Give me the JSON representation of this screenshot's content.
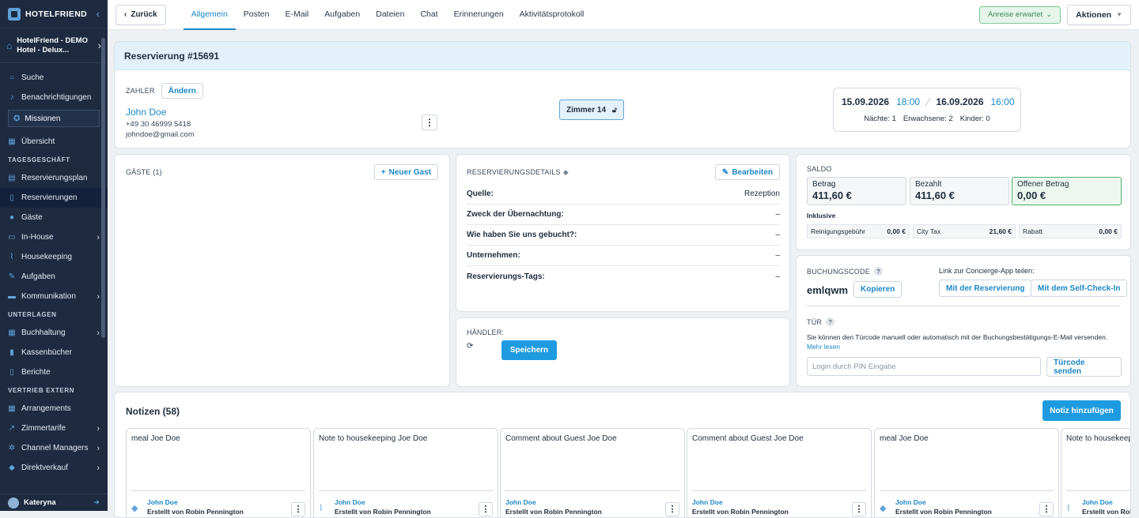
{
  "sidebar": {
    "brand": "HOTELFRIEND",
    "hotel": "HotelFriend - DEMO Hotel - Delux...",
    "search": "Suche",
    "notifications": "Benachrichtigungen",
    "missions": "Missionen",
    "overview": "Übersicht",
    "sections": [
      "TAGESGESCHÄFT",
      "UNTERLAGEN",
      "VERTRIEB EXTERN"
    ],
    "items_daily": [
      "Reservierungsplan",
      "Reservierungen",
      "Gäste",
      "In-House",
      "Housekeeping",
      "Aufgaben",
      "Kommunikation"
    ],
    "items_docs": [
      "Buchhaltung",
      "Kassenbücher",
      "Berichte"
    ],
    "items_sales": [
      "Arrangements",
      "Zimmertarife",
      "Channel Managers",
      "Direktverkauf"
    ],
    "user": "Kateryna"
  },
  "topbar": {
    "back": "Zurück",
    "tabs": [
      "Allgemein",
      "Posten",
      "E-Mail",
      "Aufgaben",
      "Dateien",
      "Chat",
      "Erinnerungen",
      "Aktivitätsprotokoll"
    ],
    "status": "Anreise erwartet",
    "actions": "Aktionen"
  },
  "reservation": {
    "title": "Reservierung #15691",
    "payer_label": "ZAHLER",
    "change": "Ändern",
    "payer_name": "John Doe",
    "payer_phone": "+49 30 46999 5418",
    "payer_email": "johndoe@gmail.com",
    "room": "Zimmer 14",
    "date_from": "15.09.2026",
    "time_from": "18:00",
    "date_to": "16.09.2026",
    "time_to": "16:00",
    "nights": "Nächte: 1",
    "adults": "Erwachsene: 2",
    "children": "Kinder: 0"
  },
  "guests": {
    "title": "GÄSTE (1)",
    "new_guest": "Neuer Gast"
  },
  "details": {
    "title": "RESERVIERUNGSDETAILS",
    "edit": "Bearbeiten",
    "rows": [
      {
        "k": "Quelle:",
        "v": "Rezeption"
      },
      {
        "k": "Zweck der Übernachtung:",
        "v": "–"
      },
      {
        "k": "Wie haben Sie uns gebucht?:",
        "v": "–"
      },
      {
        "k": "Unternehmen:",
        "v": "–"
      },
      {
        "k": "Reservierungs-Tags:",
        "v": "–"
      }
    ]
  },
  "dealer": {
    "title": "HÄNDLER:",
    "save": "Speichern"
  },
  "saldo": {
    "title": "SALDO",
    "amount_label": "Betrag",
    "amount": "411,60 €",
    "paid_label": "Bezahlt",
    "paid": "411,60 €",
    "open_label": "Offener Betrag",
    "open": "0,00 €",
    "incl": "Inklusive",
    "fees": [
      {
        "k": "Reinigungsgebühr",
        "v": "0,00 €"
      },
      {
        "k": "City Tax",
        "v": "21,60 €"
      },
      {
        "k": "Rabatt",
        "v": "0,00 €"
      }
    ]
  },
  "booking": {
    "title": "BUCHUNGSCODE",
    "code": "emlqwm",
    "copy": "Kopieren",
    "share_label": "Link zur Concierge-App teilen:",
    "with_res": "Mit der Reservierung",
    "with_checkin": "Mit dem Self-Check-In",
    "door_title": "TÜR",
    "door_text": "Sie können den Türcode manuell oder automatisch mit der Buchungsbestätigungs-E-Mail versenden.",
    "more": "Mehr lesen",
    "pin_placeholder": "Login durch PIN Eingabe",
    "send_code": "Türcode senden"
  },
  "notes": {
    "title": "Notizen (58)",
    "add": "Notiz hinzufügen",
    "items": [
      {
        "text": "meal Joe Doe",
        "name": "John Doe",
        "by": "Erstellt von Robin Pennington"
      },
      {
        "text": "Note to housekeeping Joe Doe",
        "name": "John Doe",
        "by": "Erstellt von Robin Pennington"
      },
      {
        "text": "Comment about Guest Joe Doe",
        "name": "John Doe",
        "by": "Erstellt von Robin Pennington"
      },
      {
        "text": "Comment about Guest Joe Doe",
        "name": "John Doe",
        "by": "Erstellt von Robin Pennington"
      },
      {
        "text": "meal Joe Doe",
        "name": "John Doe",
        "by": "Erstellt von Robin Pennington"
      },
      {
        "text": "Note to housekeeping Joe Doe",
        "name": "John Doe",
        "by": "Erstellt von Robin Pennington"
      }
    ]
  }
}
